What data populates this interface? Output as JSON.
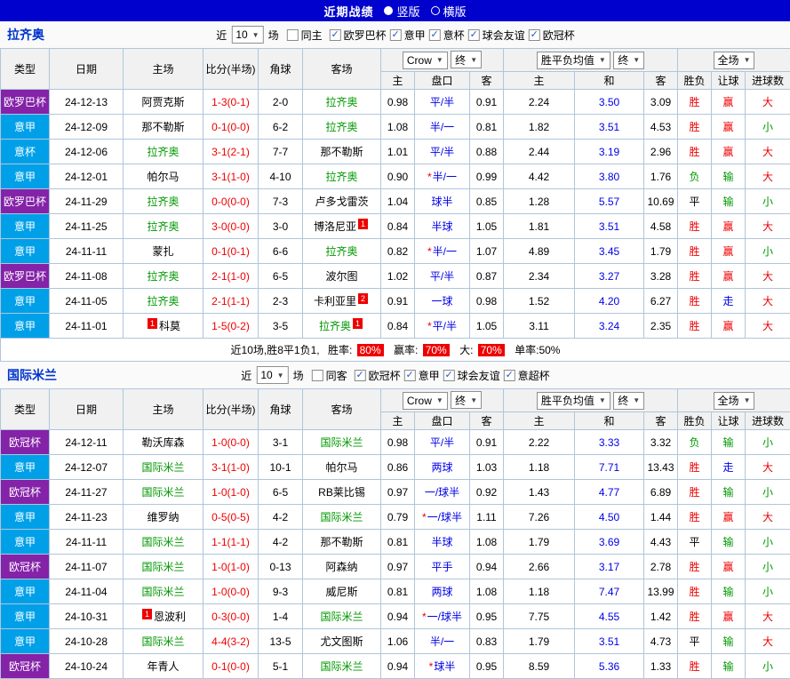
{
  "topbar": {
    "title": "近期战绩",
    "radio_vertical": "竖版",
    "radio_horizontal": "横版"
  },
  "labels": {
    "near": "近",
    "games": "场"
  },
  "columns": {
    "type": "类型",
    "date": "日期",
    "home": "主场",
    "score": "比分(半场)",
    "corner": "角球",
    "away": "客场",
    "bookmaker": "Crow",
    "final": "终",
    "avg": "胜平负均值",
    "final2": "终",
    "scope": "全场",
    "odds_home": "主",
    "handicap": "盘口",
    "odds_away": "客",
    "avg_home": "主",
    "avg_draw": "和",
    "avg_away": "客",
    "result": "胜负",
    "cover": "让球",
    "goals": "进球数"
  },
  "colors": {
    "topbar_bg": "#0101CE",
    "title_blue": "#0033CC",
    "score_red": "#EE0000",
    "focal_green": "#009900",
    "odds_blue": "#0000E6",
    "badge_red": "#EE0000",
    "pct_bg": "#EE0000",
    "grid": "#AFC6DB",
    "header_bg": "#F1F1F1"
  },
  "league_colors": {
    "欧罗巴杯": "#8422A8",
    "欧冠杯": "#8422A8",
    "意甲": "#00A0E9",
    "意杯": "#00A0E9"
  },
  "sections": [
    {
      "team": "拉齐奥",
      "near_count": "10",
      "same_label": "同主",
      "leagues": [
        "欧罗巴杯",
        "意甲",
        "意杯",
        "球会友谊",
        "欧冠杯"
      ],
      "rows": [
        {
          "lg": "欧罗巴杯",
          "date": "24-12-13",
          "home": "阿贾克斯",
          "hf": false,
          "hb": "",
          "score": "1-3(0-1)",
          "corner": "2-0",
          "away": "拉齐奥",
          "af": true,
          "ab": "",
          "o1": "0.98",
          "hcap": "平/半",
          "star": false,
          "o2": "0.91",
          "a1": "2.24",
          "a2": "3.50",
          "a3": "3.09",
          "res": "胜",
          "resc": "red",
          "cov": "赢",
          "covc": "red",
          "big": "大",
          "bigc": "red"
        },
        {
          "lg": "意甲",
          "date": "24-12-09",
          "home": "那不勒斯",
          "hf": false,
          "hb": "",
          "score": "0-1(0-0)",
          "corner": "6-2",
          "away": "拉齐奥",
          "af": true,
          "ab": "",
          "o1": "1.08",
          "hcap": "半/一",
          "star": false,
          "o2": "0.81",
          "a1": "1.82",
          "a2": "3.51",
          "a3": "4.53",
          "res": "胜",
          "resc": "red",
          "cov": "赢",
          "covc": "red",
          "big": "小",
          "bigc": "green"
        },
        {
          "lg": "意杯",
          "date": "24-12-06",
          "home": "拉齐奥",
          "hf": true,
          "hb": "",
          "score": "3-1(2-1)",
          "corner": "7-7",
          "away": "那不勒斯",
          "af": false,
          "ab": "",
          "o1": "1.01",
          "hcap": "平/半",
          "star": false,
          "o2": "0.88",
          "a1": "2.44",
          "a2": "3.19",
          "a3": "2.96",
          "res": "胜",
          "resc": "red",
          "cov": "赢",
          "covc": "red",
          "big": "大",
          "bigc": "red"
        },
        {
          "lg": "意甲",
          "date": "24-12-01",
          "home": "帕尔马",
          "hf": false,
          "hb": "",
          "score": "3-1(1-0)",
          "corner": "4-10",
          "away": "拉齐奥",
          "af": true,
          "ab": "",
          "o1": "0.90",
          "hcap": "半/一",
          "star": true,
          "o2": "0.99",
          "a1": "4.42",
          "a2": "3.80",
          "a3": "1.76",
          "res": "负",
          "resc": "green",
          "cov": "输",
          "covc": "green",
          "big": "大",
          "bigc": "red"
        },
        {
          "lg": "欧罗巴杯",
          "date": "24-11-29",
          "home": "拉齐奥",
          "hf": true,
          "hb": "",
          "score": "0-0(0-0)",
          "corner": "7-3",
          "away": "卢多戈雷茨",
          "af": false,
          "ab": "",
          "o1": "1.04",
          "hcap": "球半",
          "star": false,
          "o2": "0.85",
          "a1": "1.28",
          "a2": "5.57",
          "a3": "10.69",
          "res": "平",
          "resc": "black",
          "cov": "输",
          "covc": "green",
          "big": "小",
          "bigc": "green"
        },
        {
          "lg": "意甲",
          "date": "24-11-25",
          "home": "拉齐奥",
          "hf": true,
          "hb": "",
          "score": "3-0(0-0)",
          "corner": "3-0",
          "away": "博洛尼亚",
          "af": false,
          "ab": "1",
          "o1": "0.84",
          "hcap": "半球",
          "star": false,
          "o2": "1.05",
          "a1": "1.81",
          "a2": "3.51",
          "a3": "4.58",
          "res": "胜",
          "resc": "red",
          "cov": "赢",
          "covc": "red",
          "big": "大",
          "bigc": "red"
        },
        {
          "lg": "意甲",
          "date": "24-11-11",
          "home": "蒙扎",
          "hf": false,
          "hb": "",
          "score": "0-1(0-1)",
          "corner": "6-6",
          "away": "拉齐奥",
          "af": true,
          "ab": "",
          "o1": "0.82",
          "hcap": "半/一",
          "star": true,
          "o2": "1.07",
          "a1": "4.89",
          "a2": "3.45",
          "a3": "1.79",
          "res": "胜",
          "resc": "red",
          "cov": "赢",
          "covc": "red",
          "big": "小",
          "bigc": "green"
        },
        {
          "lg": "欧罗巴杯",
          "date": "24-11-08",
          "home": "拉齐奥",
          "hf": true,
          "hb": "",
          "score": "2-1(1-0)",
          "corner": "6-5",
          "away": "波尔图",
          "af": false,
          "ab": "",
          "o1": "1.02",
          "hcap": "平/半",
          "star": false,
          "o2": "0.87",
          "a1": "2.34",
          "a2": "3.27",
          "a3": "3.28",
          "res": "胜",
          "resc": "red",
          "cov": "赢",
          "covc": "red",
          "big": "大",
          "bigc": "red"
        },
        {
          "lg": "意甲",
          "date": "24-11-05",
          "home": "拉齐奥",
          "hf": true,
          "hb": "",
          "score": "2-1(1-1)",
          "corner": "2-3",
          "away": "卡利亚里",
          "af": false,
          "ab": "2",
          "o1": "0.91",
          "hcap": "一球",
          "star": false,
          "o2": "0.98",
          "a1": "1.52",
          "a2": "4.20",
          "a3": "6.27",
          "res": "胜",
          "resc": "red",
          "cov": "走",
          "covc": "blue",
          "big": "大",
          "bigc": "red"
        },
        {
          "lg": "意甲",
          "date": "24-11-01",
          "home": "科莫",
          "hf": false,
          "hb": "1",
          "score": "1-5(0-2)",
          "corner": "3-5",
          "away": "拉齐奥",
          "af": true,
          "ab": "1",
          "o1": "0.84",
          "hcap": "平/半",
          "star": true,
          "o2": "1.05",
          "a1": "3.11",
          "a2": "3.24",
          "a3": "2.35",
          "res": "胜",
          "resc": "red",
          "cov": "赢",
          "covc": "red",
          "big": "大",
          "bigc": "red"
        }
      ],
      "summary": {
        "prefix": "近10场,胜8平1负1,",
        "win_label": "胜率:",
        "win_pct": "80%",
        "cover_label": "赢率:",
        "cover_pct": "70%",
        "big_label": "大:",
        "big_pct": "70%",
        "single_label": "单率:50%"
      }
    },
    {
      "team": "国际米兰",
      "near_count": "10",
      "same_label": "同客",
      "leagues": [
        "欧冠杯",
        "意甲",
        "球会友谊",
        "意超杯"
      ],
      "rows": [
        {
          "lg": "欧冠杯",
          "date": "24-12-11",
          "home": "勒沃库森",
          "hf": false,
          "hb": "",
          "score": "1-0(0-0)",
          "corner": "3-1",
          "away": "国际米兰",
          "af": true,
          "ab": "",
          "o1": "0.98",
          "hcap": "平/半",
          "star": false,
          "o2": "0.91",
          "a1": "2.22",
          "a2": "3.33",
          "a3": "3.32",
          "res": "负",
          "resc": "green",
          "cov": "输",
          "covc": "green",
          "big": "小",
          "bigc": "green"
        },
        {
          "lg": "意甲",
          "date": "24-12-07",
          "home": "国际米兰",
          "hf": true,
          "hb": "",
          "score": "3-1(1-0)",
          "corner": "10-1",
          "away": "帕尔马",
          "af": false,
          "ab": "",
          "o1": "0.86",
          "hcap": "两球",
          "star": false,
          "o2": "1.03",
          "a1": "1.18",
          "a2": "7.71",
          "a3": "13.43",
          "res": "胜",
          "resc": "red",
          "cov": "走",
          "covc": "blue",
          "big": "大",
          "bigc": "red"
        },
        {
          "lg": "欧冠杯",
          "date": "24-11-27",
          "home": "国际米兰",
          "hf": true,
          "hb": "",
          "score": "1-0(1-0)",
          "corner": "6-5",
          "away": "RB莱比锡",
          "af": false,
          "ab": "",
          "o1": "0.97",
          "hcap": "一/球半",
          "star": false,
          "o2": "0.92",
          "a1": "1.43",
          "a2": "4.77",
          "a3": "6.89",
          "res": "胜",
          "resc": "red",
          "cov": "输",
          "covc": "green",
          "big": "小",
          "bigc": "green"
        },
        {
          "lg": "意甲",
          "date": "24-11-23",
          "home": "维罗纳",
          "hf": false,
          "hb": "",
          "score": "0-5(0-5)",
          "corner": "4-2",
          "away": "国际米兰",
          "af": true,
          "ab": "",
          "o1": "0.79",
          "hcap": "一/球半",
          "star": true,
          "o2": "1.11",
          "a1": "7.26",
          "a2": "4.50",
          "a3": "1.44",
          "res": "胜",
          "resc": "red",
          "cov": "赢",
          "covc": "red",
          "big": "大",
          "bigc": "red"
        },
        {
          "lg": "意甲",
          "date": "24-11-11",
          "home": "国际米兰",
          "hf": true,
          "hb": "",
          "score": "1-1(1-1)",
          "corner": "4-2",
          "away": "那不勒斯",
          "af": false,
          "ab": "",
          "o1": "0.81",
          "hcap": "半球",
          "star": false,
          "o2": "1.08",
          "a1": "1.79",
          "a2": "3.69",
          "a3": "4.43",
          "res": "平",
          "resc": "black",
          "cov": "输",
          "covc": "green",
          "big": "小",
          "bigc": "green"
        },
        {
          "lg": "欧冠杯",
          "date": "24-11-07",
          "home": "国际米兰",
          "hf": true,
          "hb": "",
          "score": "1-0(1-0)",
          "corner": "0-13",
          "away": "阿森纳",
          "af": false,
          "ab": "",
          "o1": "0.97",
          "hcap": "平手",
          "star": false,
          "o2": "0.94",
          "a1": "2.66",
          "a2": "3.17",
          "a3": "2.78",
          "res": "胜",
          "resc": "red",
          "cov": "赢",
          "covc": "red",
          "big": "小",
          "bigc": "green"
        },
        {
          "lg": "意甲",
          "date": "24-11-04",
          "home": "国际米兰",
          "hf": true,
          "hb": "",
          "score": "1-0(0-0)",
          "corner": "9-3",
          "away": "威尼斯",
          "af": false,
          "ab": "",
          "o1": "0.81",
          "hcap": "两球",
          "star": false,
          "o2": "1.08",
          "a1": "1.18",
          "a2": "7.47",
          "a3": "13.99",
          "res": "胜",
          "resc": "red",
          "cov": "输",
          "covc": "green",
          "big": "小",
          "bigc": "green"
        },
        {
          "lg": "意甲",
          "date": "24-10-31",
          "home": "恩波利",
          "hf": false,
          "hb": "1",
          "score": "0-3(0-0)",
          "corner": "1-4",
          "away": "国际米兰",
          "af": true,
          "ab": "",
          "o1": "0.94",
          "hcap": "一/球半",
          "star": true,
          "o2": "0.95",
          "a1": "7.75",
          "a2": "4.55",
          "a3": "1.42",
          "res": "胜",
          "resc": "red",
          "cov": "赢",
          "covc": "red",
          "big": "大",
          "bigc": "red"
        },
        {
          "lg": "意甲",
          "date": "24-10-28",
          "home": "国际米兰",
          "hf": true,
          "hb": "",
          "score": "4-4(3-2)",
          "corner": "13-5",
          "away": "尤文图斯",
          "af": false,
          "ab": "",
          "o1": "1.06",
          "hcap": "半/一",
          "star": false,
          "o2": "0.83",
          "a1": "1.79",
          "a2": "3.51",
          "a3": "4.73",
          "res": "平",
          "resc": "black",
          "cov": "输",
          "covc": "green",
          "big": "大",
          "bigc": "red"
        },
        {
          "lg": "欧冠杯",
          "date": "24-10-24",
          "home": "年青人",
          "hf": false,
          "hb": "",
          "score": "0-1(0-0)",
          "corner": "5-1",
          "away": "国际米兰",
          "af": true,
          "ab": "",
          "o1": "0.94",
          "hcap": "球半",
          "star": true,
          "o2": "0.95",
          "a1": "8.59",
          "a2": "5.36",
          "a3": "1.33",
          "res": "胜",
          "resc": "red",
          "cov": "输",
          "covc": "green",
          "big": "小",
          "bigc": "green"
        }
      ]
    }
  ]
}
